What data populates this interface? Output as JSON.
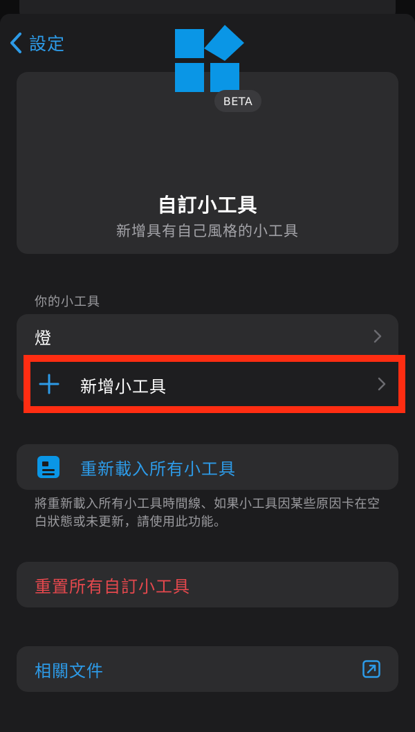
{
  "nav": {
    "back_label": "設定"
  },
  "hero": {
    "badge": "BETA",
    "title": "自訂小工具",
    "subtitle": "新增具有自己風格的小工具",
    "accent_color": "#0a96e6"
  },
  "widgets_section": {
    "header": "你的小工具",
    "items": [
      {
        "label": "燈"
      },
      {
        "label": "新增小工具"
      }
    ]
  },
  "reload": {
    "label": "重新載入所有小工具",
    "note": "將重新載入所有小工具時間線、如果小工具因某些原因卡在空白狀態或未更新，請使用此功能。"
  },
  "reset": {
    "label": "重置所有自訂小工具",
    "color": "#e5484d"
  },
  "docs": {
    "label": "相關文件"
  },
  "icons": {
    "back": "chevron-left-icon",
    "logo": "widgets-logo-icon",
    "chevron": "chevron-right-icon",
    "add": "plus-icon",
    "reload": "document-list-icon",
    "external": "external-link-icon"
  },
  "colors": {
    "link": "#2d9be8",
    "highlight": "#ff2d12"
  }
}
